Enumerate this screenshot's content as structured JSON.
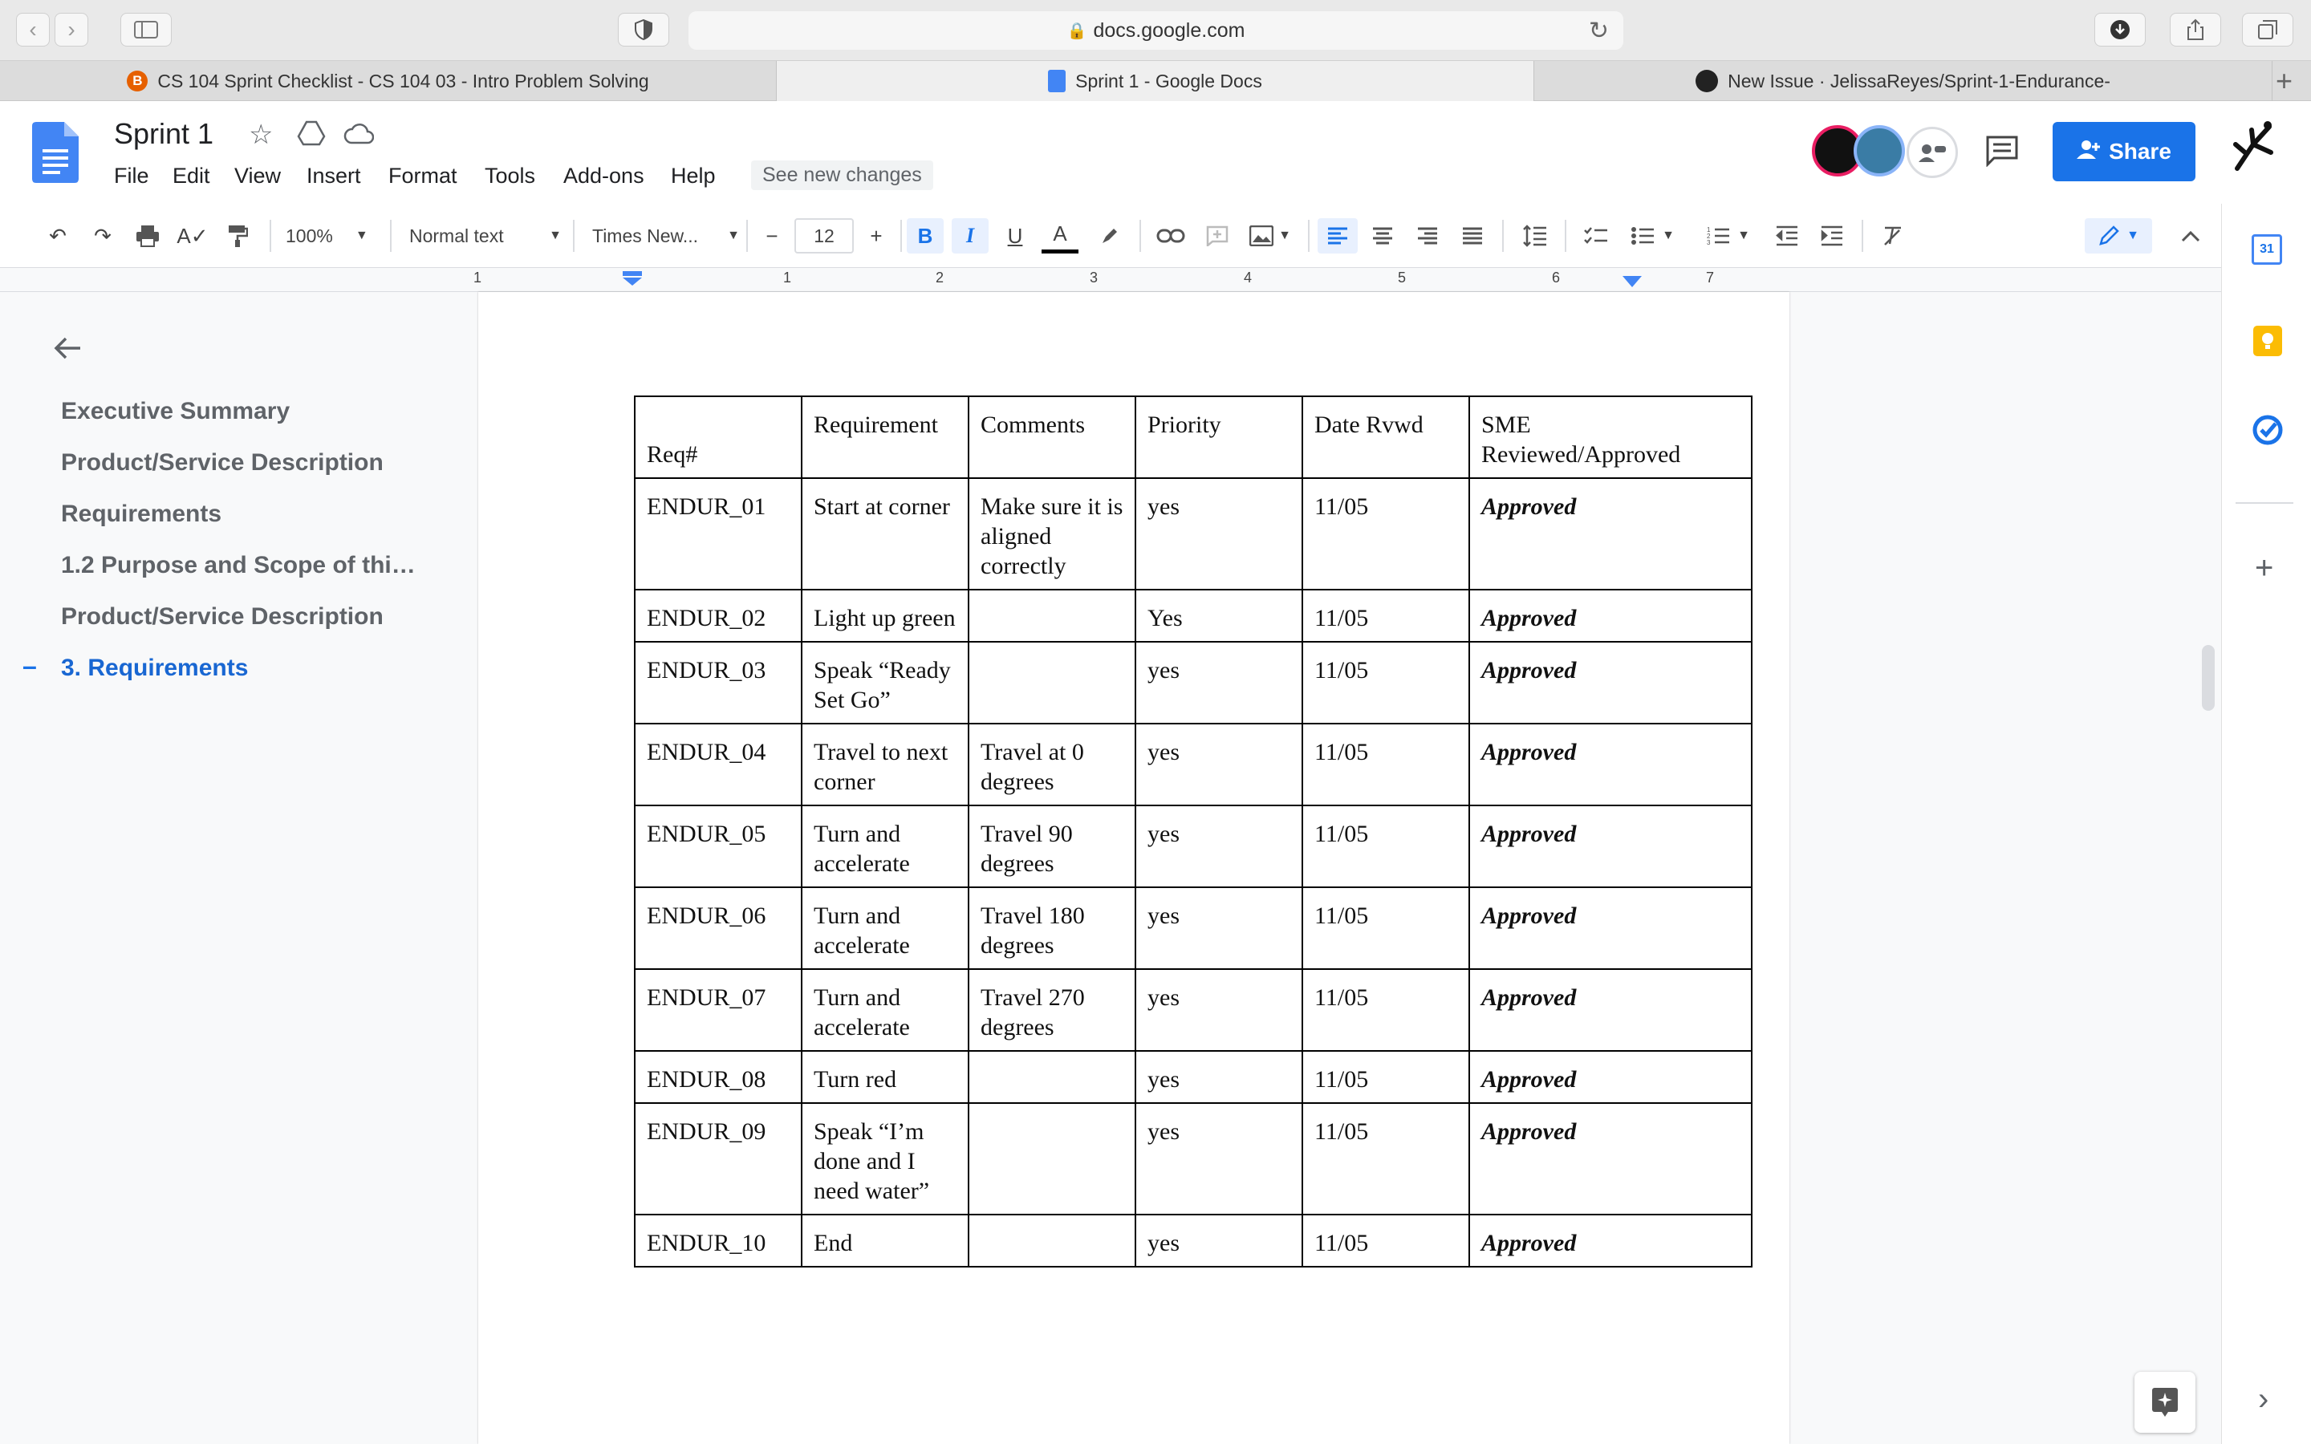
{
  "browser": {
    "url": "docs.google.com",
    "tabs": [
      {
        "label": "CS 104 Sprint Checklist - CS 104 03 - Intro Problem Solving"
      },
      {
        "label": "Sprint 1 - Google Docs"
      },
      {
        "label": "New Issue · JelissaReyes/Sprint-1-Endurance-"
      }
    ]
  },
  "doc": {
    "title": "Sprint 1",
    "menus": [
      "File",
      "Edit",
      "View",
      "Insert",
      "Format",
      "Tools",
      "Add-ons",
      "Help"
    ],
    "see_changes": "See new changes",
    "share_label": "Share"
  },
  "toolbar": {
    "zoom": "100%",
    "style": "Normal text",
    "font": "Times New...",
    "font_size": "12",
    "minus": "−",
    "plus": "+",
    "bold": "B",
    "italic": "I",
    "underline": "U",
    "text_color": "A"
  },
  "ruler": [
    "1",
    "1",
    "2",
    "3",
    "4",
    "5",
    "6",
    "7"
  ],
  "outline": {
    "items": [
      "Executive Summary",
      "Product/Service Description",
      "Requirements",
      "1.2 Purpose and Scope of thi…",
      "Product/Service Description",
      "3. Requirements"
    ],
    "active_marker": "–"
  },
  "table": {
    "headers": [
      "Req#",
      "Requirement",
      "Comments",
      "Priority",
      "Date Rvwd",
      "SME Reviewed/Approved"
    ],
    "rows": [
      [
        "ENDUR_01",
        "Start at corner",
        "Make sure it is aligned correctly",
        "yes",
        "11/05",
        "Approved"
      ],
      [
        "ENDUR_02",
        "Light up green",
        "",
        "Yes",
        "11/05",
        "Approved"
      ],
      [
        "ENDUR_03",
        "Speak “Ready Set Go”",
        "",
        "yes",
        "11/05",
        "Approved"
      ],
      [
        "ENDUR_04",
        "Travel to next corner",
        "Travel at 0 degrees",
        "yes",
        "11/05",
        "Approved"
      ],
      [
        "ENDUR_05",
        "Turn and accelerate",
        "Travel 90 degrees",
        "yes",
        "11/05",
        "Approved"
      ],
      [
        "ENDUR_06",
        "Turn and accelerate",
        "Travel 180 degrees",
        "yes",
        "11/05",
        "Approved"
      ],
      [
        "ENDUR_07",
        "Turn and accelerate",
        "Travel 270 degrees",
        "yes",
        "11/05",
        "Approved"
      ],
      [
        "ENDUR_08",
        "Turn red",
        "",
        "yes",
        "11/05",
        "Approved"
      ],
      [
        "ENDUR_09",
        "Speak “I’m done and I need water”",
        "",
        "yes",
        "11/05",
        "Approved"
      ],
      [
        "ENDUR_10",
        "End",
        "",
        "yes",
        "11/05",
        "Approved"
      ]
    ]
  },
  "side_panel": {
    "calendar_day": "31",
    "add": "+",
    "collapse": "›"
  },
  "colors": {
    "accent": "#1a73e8",
    "share_bg": "#1a73e8",
    "docs_blue": "#4285f4"
  }
}
